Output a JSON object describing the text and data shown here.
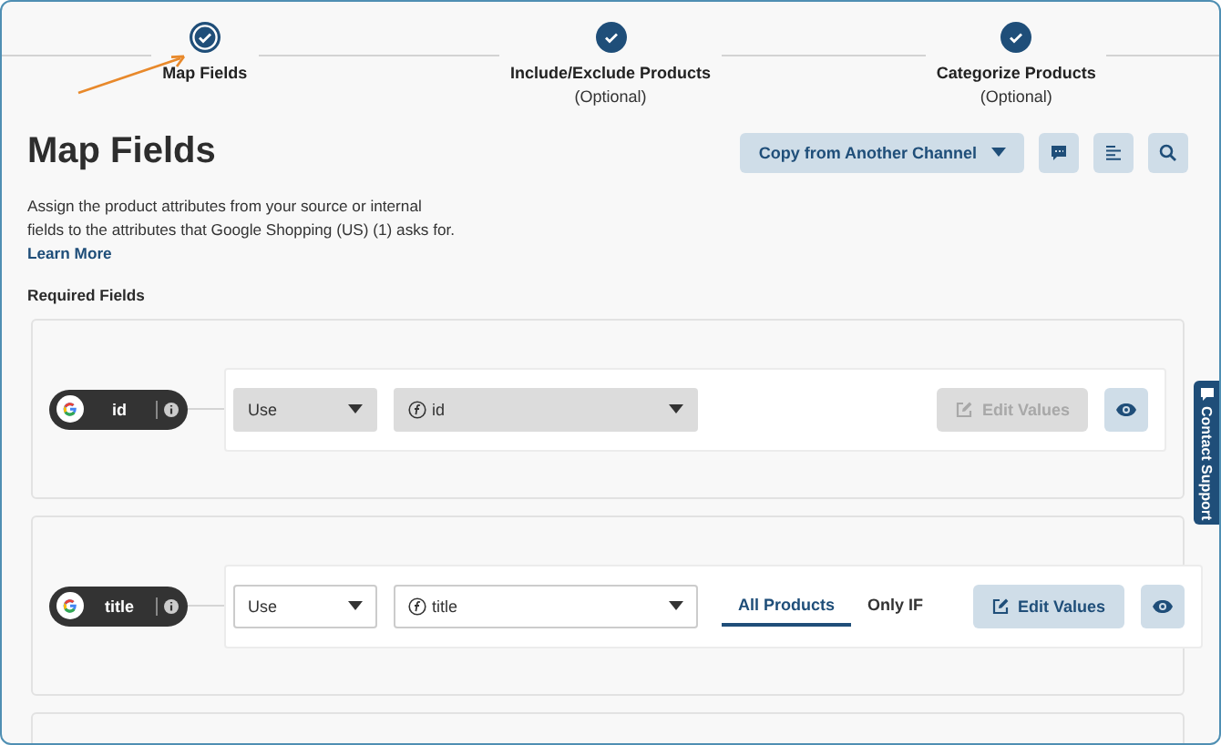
{
  "steps": [
    {
      "label": "Map Fields",
      "current": true
    },
    {
      "label": "Include/Exclude Products",
      "note": "(Optional)",
      "current": false
    },
    {
      "label": "Categorize Products",
      "note": "(Optional)",
      "current": false
    }
  ],
  "heading": "Map Fields",
  "copy_button": "Copy from Another Channel",
  "description": "Assign the product attributes from your source or internal fields to the attributes that Google Shopping (US) (1) asks for.",
  "learn_more": "Learn More",
  "section_title": "Required Fields",
  "fields": [
    {
      "name": "id",
      "disabled": true,
      "operator": "Use",
      "source": "id",
      "edit_label": "Edit Values"
    },
    {
      "name": "title",
      "disabled": false,
      "operator": "Use",
      "source": "title",
      "tabs": [
        {
          "label": "All Products",
          "selected": true
        },
        {
          "label": "Only IF",
          "selected": false
        }
      ],
      "edit_label": "Edit Values"
    }
  ],
  "contact_support": "Contact Support"
}
